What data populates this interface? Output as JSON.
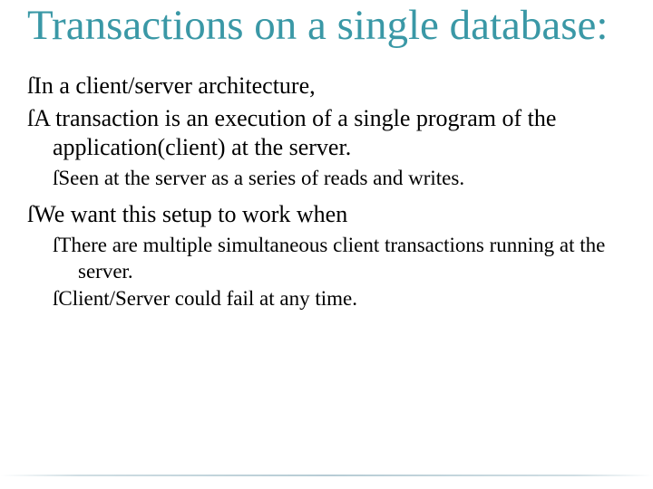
{
  "title": "Transactions on a single database:",
  "bullets": {
    "b1": "In a client/server architecture,",
    "b2": "A transaction is an execution of a single program of the application(client) at the server.",
    "b2a": "Seen at the server as a series of reads and writes.",
    "b3": "We want this setup to work when",
    "b3a": "There are multiple simultaneous client transactions running at the server.",
    "b3b": "Client/Server could fail at any time."
  },
  "glyph": ""
}
